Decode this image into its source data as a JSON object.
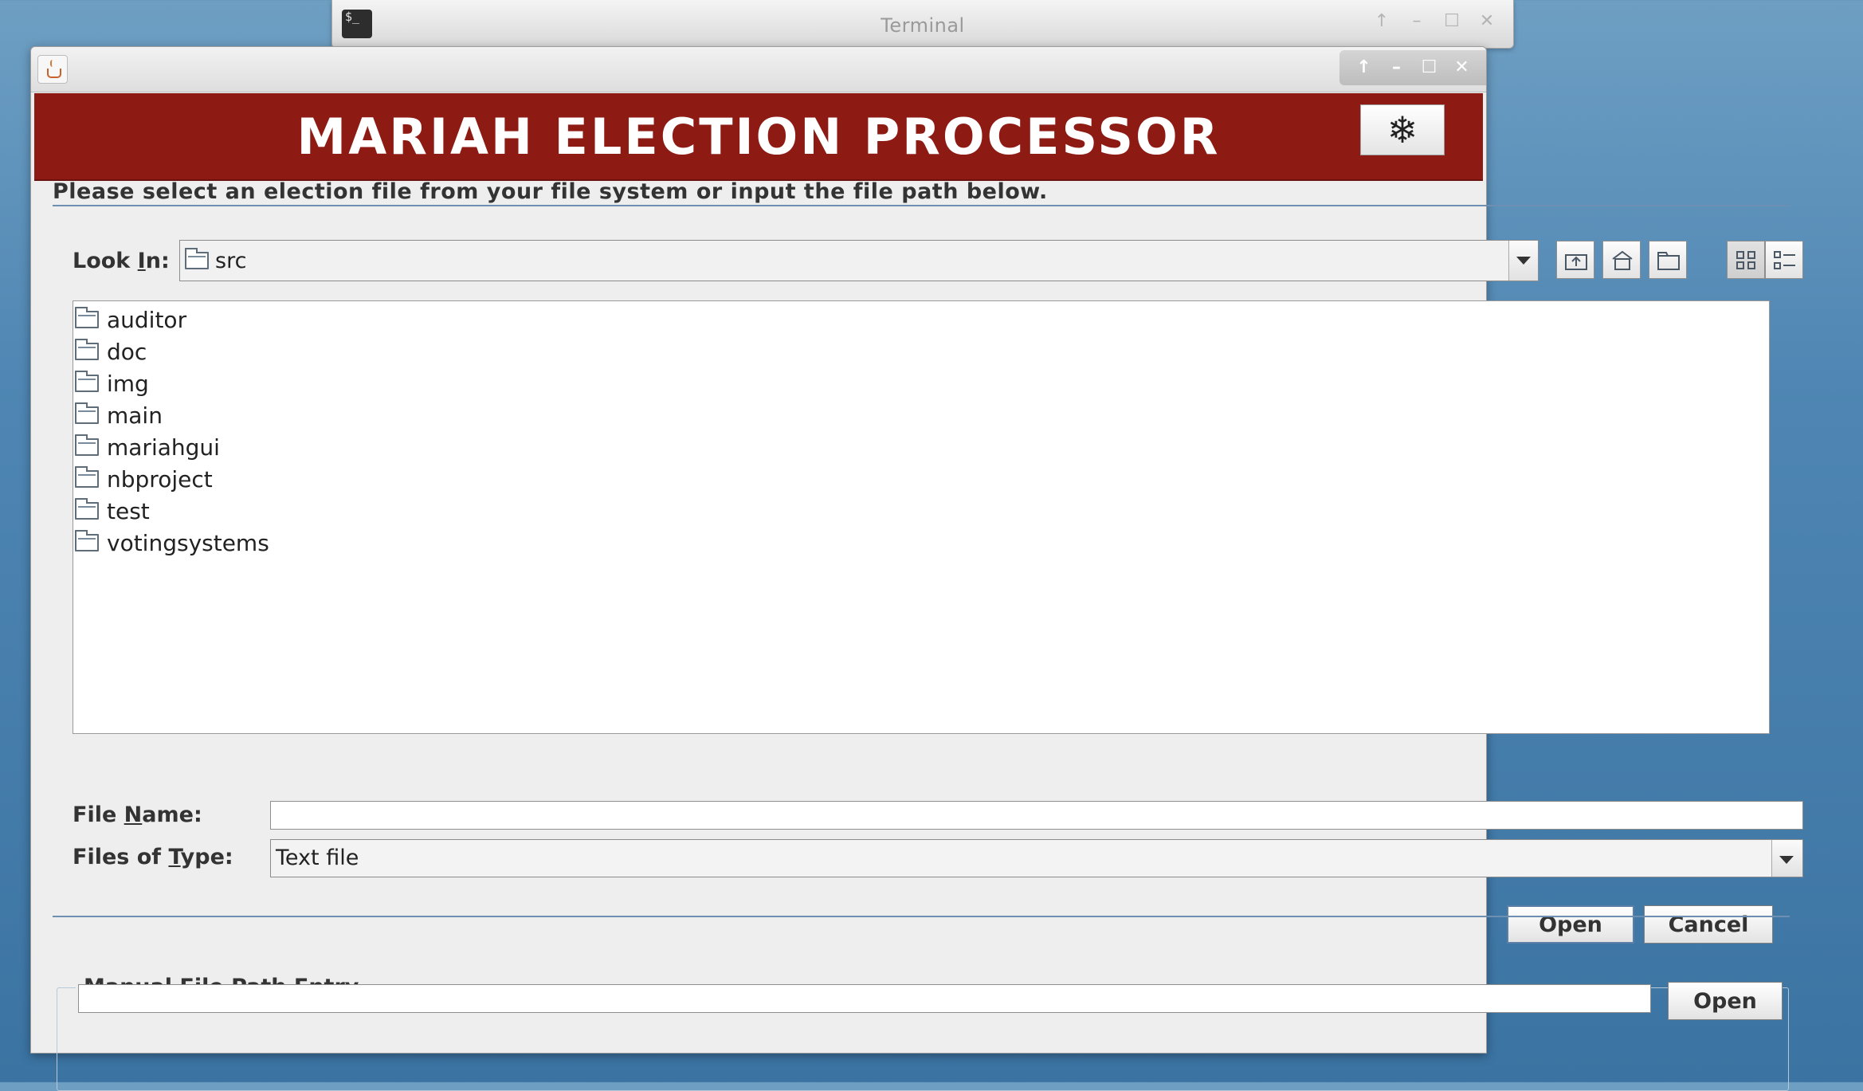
{
  "terminal_window": {
    "title": "Terminal",
    "icon_label": "$_"
  },
  "main_window": {
    "banner_title": "MARIAH ELECTION PROCESSOR",
    "settings_icon": "snowflake-icon",
    "accent_color": "#8e1a14",
    "instruction": "Please select an election file from your file system or input the file path below."
  },
  "file_chooser": {
    "look_in_label_pre": "Look ",
    "look_in_label_mnemonic": "I",
    "look_in_label_post": "n:",
    "look_in_value": "src",
    "toolbar": [
      "up-one-level-icon",
      "home-icon",
      "new-folder-icon",
      "list-view-icon",
      "details-view-icon"
    ],
    "files": [
      {
        "name": "auditor"
      },
      {
        "name": "doc"
      },
      {
        "name": "img"
      },
      {
        "name": "main"
      },
      {
        "name": "mariahgui"
      },
      {
        "name": "nbproject"
      },
      {
        "name": "test"
      },
      {
        "name": "votingsystems"
      }
    ],
    "file_name_label_pre": "File ",
    "file_name_label_mnemonic": "N",
    "file_name_label_post": "ame:",
    "file_name_value": "",
    "files_of_type_label_pre": "Files of ",
    "files_of_type_label_mnemonic": "T",
    "files_of_type_label_post": "ype:",
    "files_of_type_value": "Text file",
    "open_label": "Open",
    "cancel_label": "Cancel"
  },
  "manual_entry": {
    "legend": "Manual File Path Entry",
    "path_value": "",
    "open_label": "Open"
  }
}
